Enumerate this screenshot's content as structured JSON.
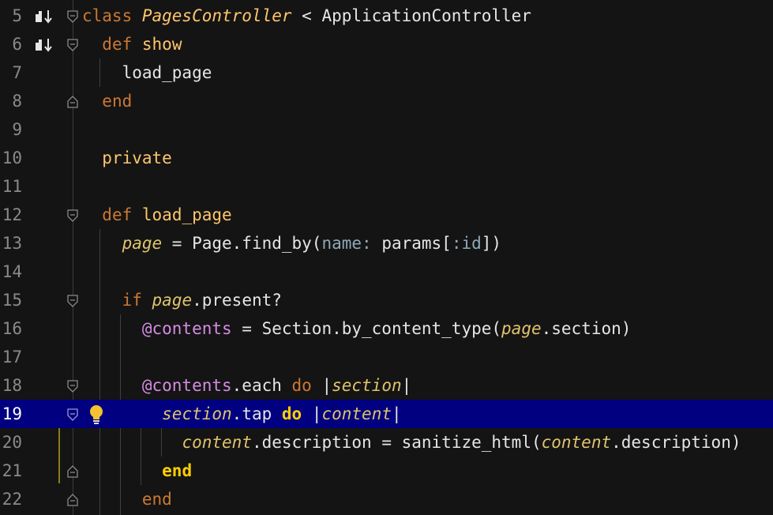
{
  "editor": {
    "language": "Ruby",
    "current_line": 19,
    "colors": {
      "background": "#141414",
      "current_line_bg": "#000080",
      "keyword": "#cc7832",
      "method_name": "#ffc66d",
      "local_variable": "#e0c46c",
      "instance_variable": "#d48ce3",
      "symbol": "#8fa8b8",
      "line_number": "#8a8a8a"
    },
    "lines": [
      {
        "n": "5",
        "c": [
          "class ",
          "PagesController",
          " < ApplicationController"
        ]
      },
      {
        "n": "6",
        "c": [
          "  ",
          "def",
          " ",
          "show"
        ]
      },
      {
        "n": "7",
        "c": [
          "    load_page"
        ]
      },
      {
        "n": "8",
        "c": [
          "  ",
          "end"
        ]
      },
      {
        "n": "9",
        "c": []
      },
      {
        "n": "10",
        "c": [
          "  ",
          "private"
        ]
      },
      {
        "n": "11",
        "c": []
      },
      {
        "n": "12",
        "c": [
          "  ",
          "def",
          " ",
          "load_page"
        ]
      },
      {
        "n": "13",
        "c": [
          "    ",
          "page",
          " = Page.find_by(",
          "name:",
          " params[",
          ":id",
          "])"
        ]
      },
      {
        "n": "14",
        "c": []
      },
      {
        "n": "15",
        "c": [
          "    ",
          "if",
          " ",
          "page",
          ".present?"
        ]
      },
      {
        "n": "16",
        "c": [
          "      ",
          "@contents",
          " = Section.by_content_type(",
          "page",
          ".section)"
        ]
      },
      {
        "n": "17",
        "c": []
      },
      {
        "n": "18",
        "c": [
          "      ",
          "@contents",
          ".each ",
          "do",
          " |",
          "section",
          "|"
        ]
      },
      {
        "n": "19",
        "c": [
          "        ",
          "section",
          ".tap ",
          "do",
          " |",
          "content",
          "|"
        ]
      },
      {
        "n": "20",
        "c": [
          "          ",
          "content",
          ".description = sanitize_html(",
          "content",
          ".description)"
        ]
      },
      {
        "n": "21",
        "c": [
          "        ",
          "end"
        ]
      },
      {
        "n": "22",
        "c": [
          "      ",
          "end"
        ]
      }
    ],
    "gutter_icons": {
      "run_icon_lines": [
        "5",
        "6"
      ],
      "intention_bulb_line": "19"
    }
  }
}
